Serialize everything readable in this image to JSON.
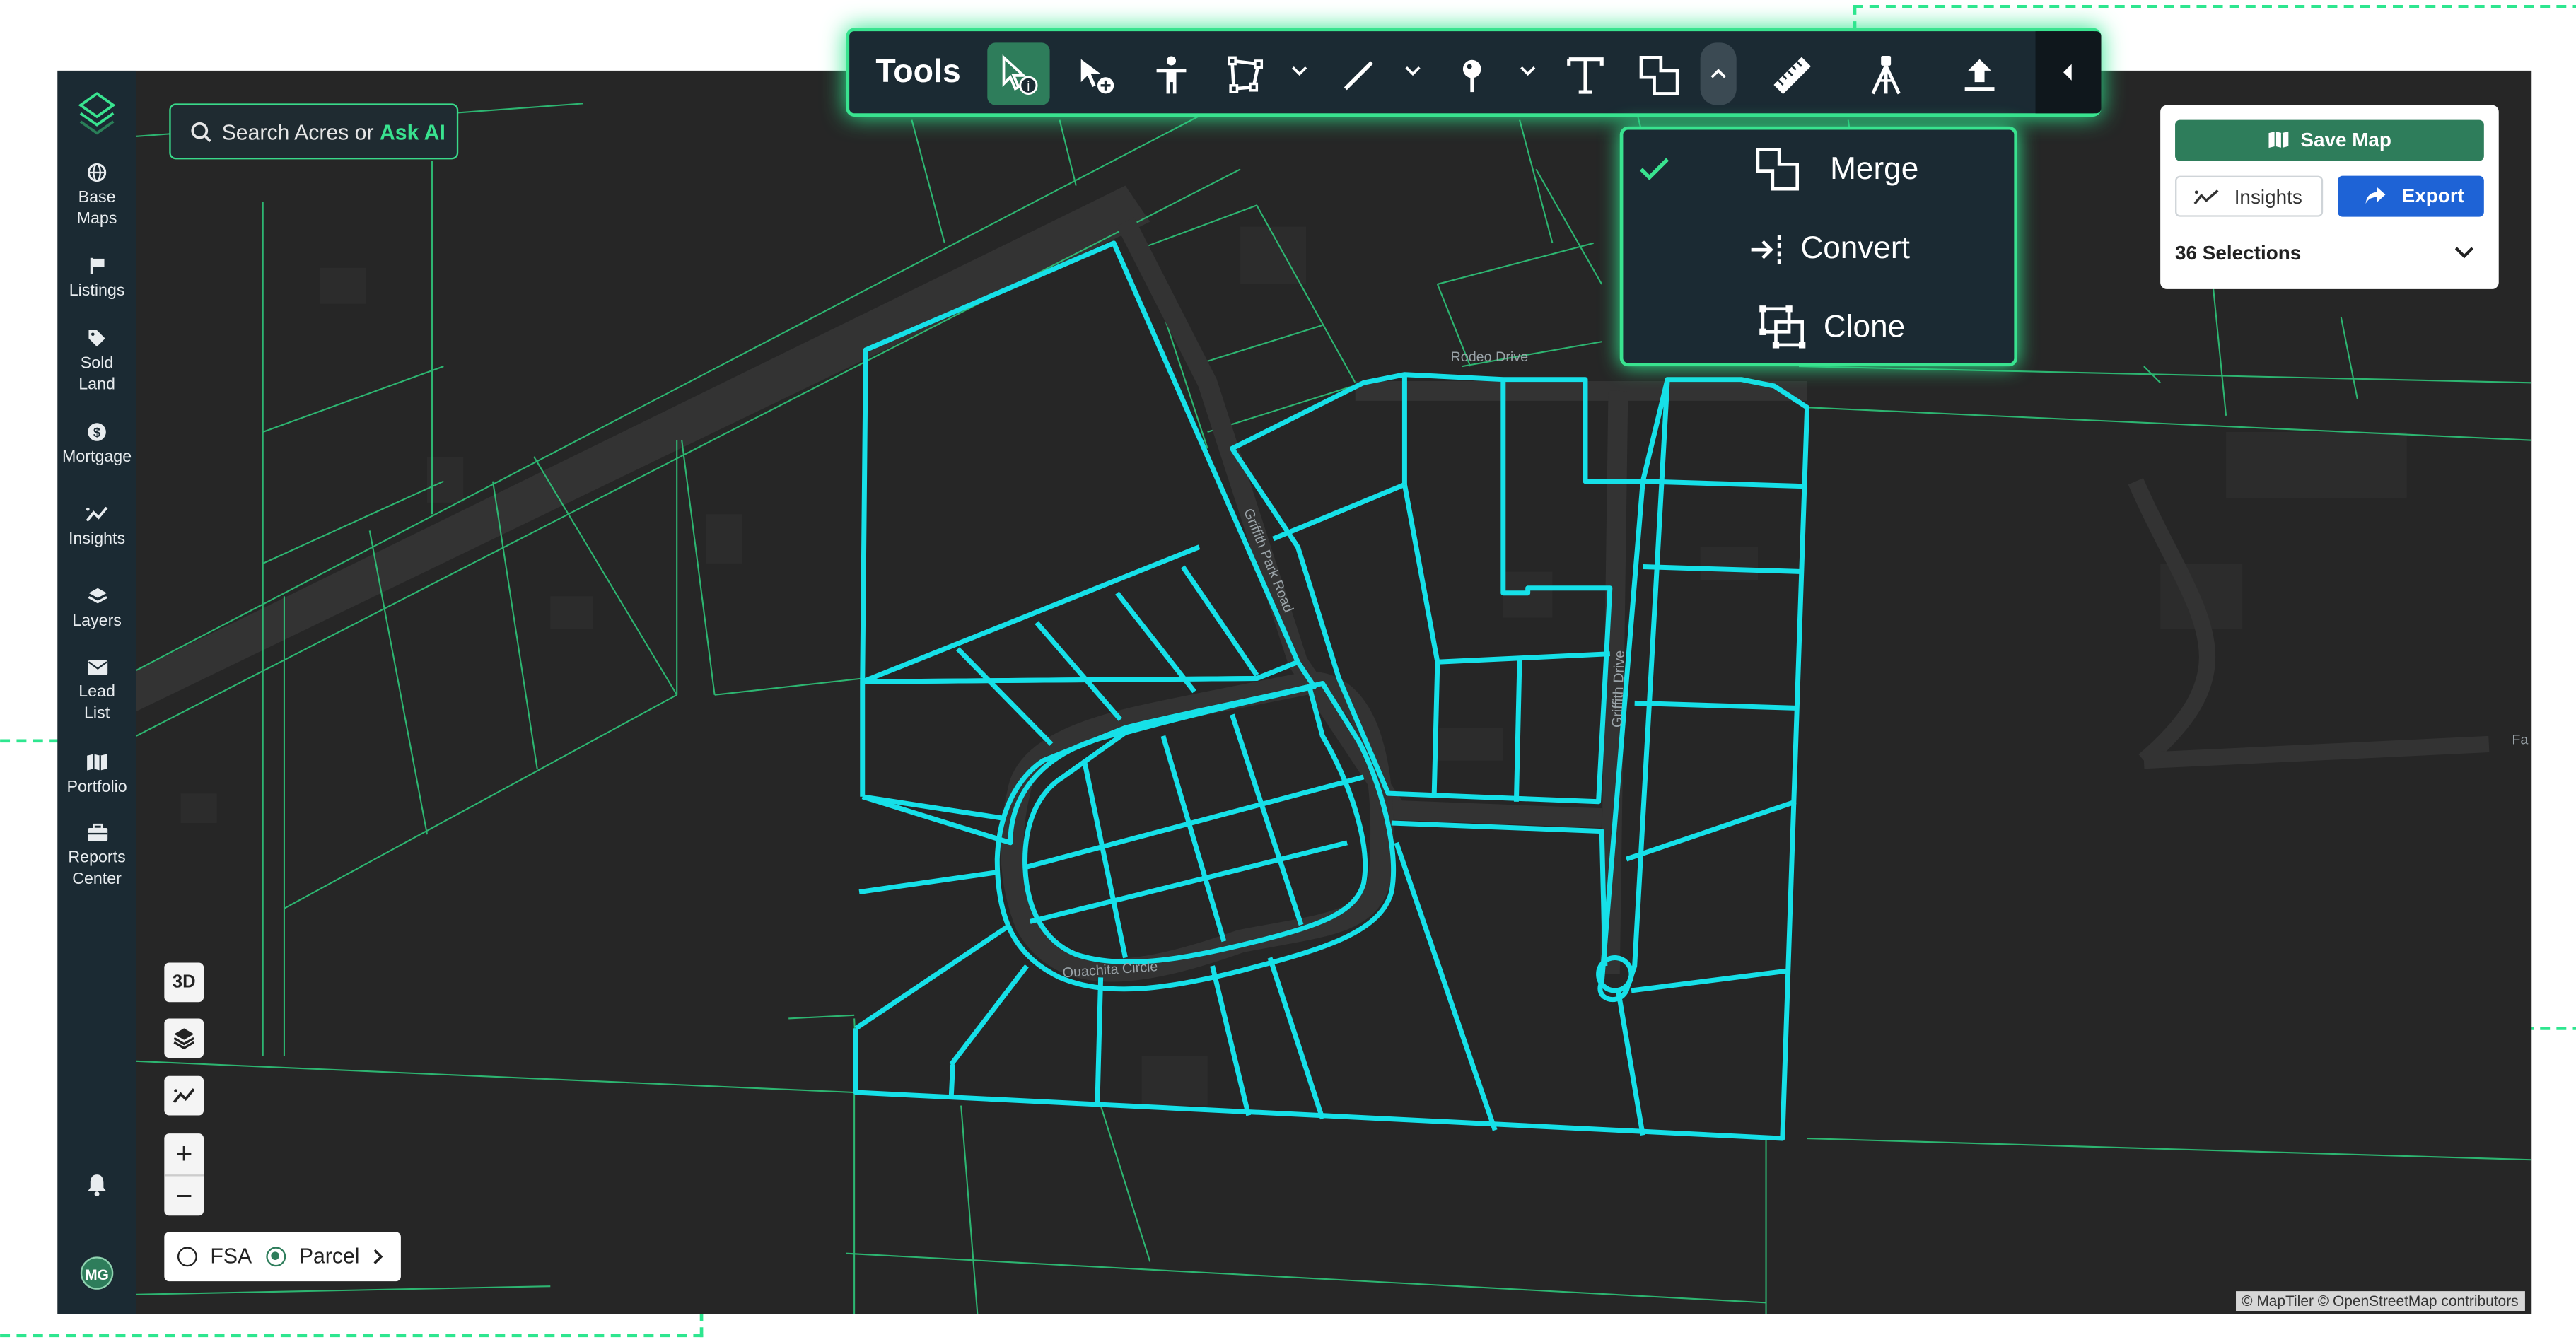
{
  "search": {
    "prefix": "Search Acres or",
    "ai_label": "Ask AI"
  },
  "sidebar": {
    "items": [
      {
        "line1": "Base",
        "line2": "Maps",
        "icon": "globe-icon"
      },
      {
        "line1": "Listings",
        "line2": "",
        "icon": "flag-icon"
      },
      {
        "line1": "Sold",
        "line2": "Land",
        "icon": "tag-icon"
      },
      {
        "line1": "Mortgage",
        "line2": "",
        "icon": "dollar-icon"
      },
      {
        "line1": "Insights",
        "line2": "",
        "icon": "trend-icon"
      },
      {
        "line1": "Layers",
        "line2": "",
        "icon": "layers-icon"
      },
      {
        "line1": "Lead",
        "line2": "List",
        "icon": "mail-icon"
      },
      {
        "line1": "Portfolio",
        "line2": "",
        "icon": "map-icon"
      },
      {
        "line1": "Reports",
        "line2": "Center",
        "icon": "briefcase-icon"
      }
    ],
    "avatar": "MG"
  },
  "toolbar": {
    "title": "Tools",
    "tools": [
      "select-info",
      "select-add",
      "person",
      "polygon",
      "line",
      "pin",
      "text",
      "merge",
      "ruler",
      "survey",
      "upload"
    ],
    "active_tool": "select-info"
  },
  "dropdown": {
    "items": [
      {
        "label": "Merge",
        "checked": true
      },
      {
        "label": "Convert",
        "checked": false
      },
      {
        "label": "Clone",
        "checked": false
      }
    ]
  },
  "panel": {
    "save_label": "Save Map",
    "insights_label": "Insights",
    "export_label": "Export",
    "selections": "36 Selections"
  },
  "map_controls": {
    "three_d": "3D",
    "zoom_in": "+",
    "zoom_out": "−"
  },
  "toggle": {
    "fsa": "FSA",
    "parcel": "Parcel",
    "selected": "Parcel"
  },
  "map": {
    "roads": [
      "Rodeo Drive",
      "Griffith Park Road",
      "Griffith Drive",
      "Ouachita Circle"
    ],
    "edge_label": "Fa"
  },
  "attribution": "© MapTiler © OpenStreetMap contributors",
  "colors": {
    "accent": "#39e38f",
    "parcel_highlight": "#16e0e8",
    "sidebar": "#1b2a33",
    "map_bg": "#262626",
    "export": "#1e63d6",
    "save": "#2e7d5b"
  }
}
